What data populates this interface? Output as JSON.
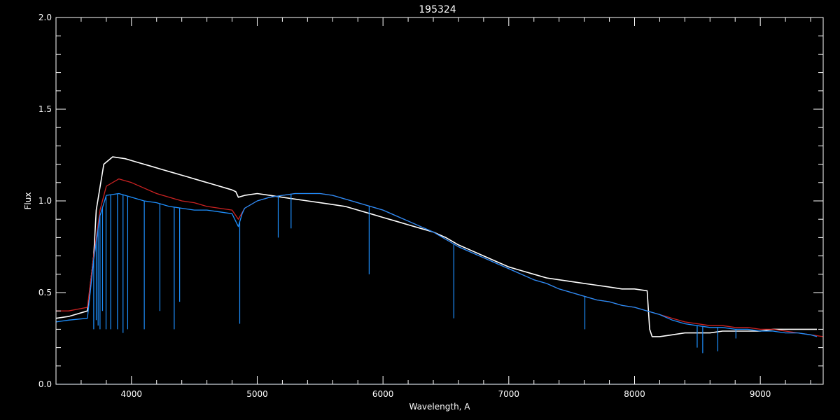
{
  "chart_data": {
    "type": "line",
    "title": "195324",
    "xlabel": "Wavelength, A",
    "ylabel": "Flux",
    "xlim": [
      3400,
      9500
    ],
    "ylim": [
      0.0,
      2.0
    ],
    "x_ticks": [
      4000,
      5000,
      6000,
      7000,
      8000,
      9000
    ],
    "y_ticks": [
      0.0,
      0.5,
      1.0,
      1.5,
      2.0
    ],
    "y_tick_labels": [
      "0.0",
      "0.5",
      "1.0",
      "1.5",
      "2.0"
    ],
    "grid": false,
    "background": "#000000",
    "axis_color": "#ffffff",
    "series": [
      {
        "color": "#ffffff",
        "x": [
          3400,
          3500,
          3650,
          3700,
          3720,
          3780,
          3850,
          3950,
          4050,
          4150,
          4250,
          4350,
          4450,
          4550,
          4650,
          4750,
          4800,
          4830,
          4850,
          4900,
          5000,
          5100,
          5200,
          5300,
          5400,
          5500,
          5600,
          5700,
          5800,
          5900,
          6000,
          6100,
          6200,
          6300,
          6400,
          6500,
          6600,
          6700,
          6800,
          6900,
          7000,
          7100,
          7200,
          7300,
          7400,
          7500,
          7600,
          7700,
          7800,
          7900,
          8000,
          8100,
          8120,
          8140,
          8200,
          8300,
          8400,
          8500,
          8600,
          8700,
          8800,
          8900,
          9000,
          9100,
          9200,
          9300,
          9400,
          9450
        ],
        "y": [
          0.36,
          0.37,
          0.4,
          0.7,
          0.95,
          1.2,
          1.24,
          1.23,
          1.21,
          1.19,
          1.17,
          1.15,
          1.13,
          1.11,
          1.09,
          1.07,
          1.06,
          1.05,
          1.02,
          1.03,
          1.04,
          1.03,
          1.02,
          1.01,
          1.0,
          0.99,
          0.98,
          0.97,
          0.95,
          0.93,
          0.91,
          0.89,
          0.87,
          0.85,
          0.83,
          0.8,
          0.76,
          0.73,
          0.7,
          0.67,
          0.64,
          0.62,
          0.6,
          0.58,
          0.57,
          0.56,
          0.55,
          0.54,
          0.53,
          0.52,
          0.52,
          0.51,
          0.3,
          0.26,
          0.26,
          0.27,
          0.28,
          0.28,
          0.28,
          0.29,
          0.29,
          0.29,
          0.29,
          0.3,
          0.3,
          0.3,
          0.3,
          0.3
        ]
      },
      {
        "color": "#cc2222",
        "x": [
          3400,
          3500,
          3650,
          3700,
          3750,
          3800,
          3900,
          4000,
          4100,
          4200,
          4300,
          4400,
          4500,
          4600,
          4700,
          4800,
          4850,
          4900,
          5000,
          5100,
          5200,
          5300,
          5400,
          5500,
          5600,
          5700,
          5800,
          5900,
          6000,
          6100,
          6200,
          6300,
          6400,
          6500,
          6600,
          6700,
          6800,
          6900,
          7000,
          7100,
          7200,
          7300,
          7400,
          7500,
          7600,
          7700,
          7800,
          7900,
          8000,
          8100,
          8200,
          8300,
          8400,
          8500,
          8600,
          8700,
          8800,
          8900,
          9000,
          9100,
          9200,
          9300,
          9400,
          9500
        ],
        "y": [
          0.4,
          0.4,
          0.42,
          0.7,
          0.95,
          1.08,
          1.12,
          1.1,
          1.07,
          1.04,
          1.02,
          1.0,
          0.99,
          0.97,
          0.96,
          0.95,
          0.9,
          0.96,
          1.0,
          1.02,
          1.03,
          1.04,
          1.04,
          1.04,
          1.03,
          1.01,
          0.99,
          0.97,
          0.95,
          0.92,
          0.89,
          0.86,
          0.83,
          0.79,
          0.75,
          0.72,
          0.69,
          0.66,
          0.63,
          0.6,
          0.57,
          0.55,
          0.52,
          0.5,
          0.48,
          0.46,
          0.45,
          0.43,
          0.42,
          0.4,
          0.38,
          0.36,
          0.34,
          0.33,
          0.32,
          0.32,
          0.31,
          0.31,
          0.3,
          0.3,
          0.29,
          0.28,
          0.27,
          0.26
        ]
      },
      {
        "color": "#1e90ff",
        "x": [
          3400,
          3500,
          3650,
          3700,
          3750,
          3800,
          3900,
          4000,
          4100,
          4200,
          4300,
          4400,
          4500,
          4600,
          4700,
          4800,
          4850,
          4880,
          4900,
          5000,
          5100,
          5200,
          5300,
          5400,
          5500,
          5600,
          5700,
          5800,
          5900,
          6000,
          6100,
          6200,
          6300,
          6400,
          6500,
          6600,
          6700,
          6800,
          6900,
          7000,
          7100,
          7200,
          7300,
          7400,
          7500,
          7600,
          7700,
          7800,
          7900,
          8000,
          8100,
          8200,
          8300,
          8400,
          8500,
          8600,
          8700,
          8800,
          8900,
          9000,
          9100,
          9200,
          9300,
          9400,
          9450
        ],
        "y": [
          0.34,
          0.35,
          0.36,
          0.68,
          0.92,
          1.03,
          1.04,
          1.02,
          1.0,
          0.99,
          0.97,
          0.96,
          0.95,
          0.95,
          0.94,
          0.93,
          0.86,
          0.93,
          0.96,
          1.0,
          1.02,
          1.03,
          1.04,
          1.04,
          1.04,
          1.03,
          1.01,
          0.99,
          0.97,
          0.95,
          0.92,
          0.89,
          0.86,
          0.83,
          0.79,
          0.75,
          0.72,
          0.69,
          0.66,
          0.63,
          0.6,
          0.57,
          0.55,
          0.52,
          0.5,
          0.48,
          0.46,
          0.45,
          0.43,
          0.42,
          0.4,
          0.38,
          0.35,
          0.33,
          0.32,
          0.31,
          0.31,
          0.3,
          0.3,
          0.29,
          0.29,
          0.28,
          0.28,
          0.27,
          0.26
        ]
      },
      {
        "color": "#1e90ff",
        "x": [
          3400,
          9450
        ],
        "y": [
          0.0,
          0.0
        ]
      }
    ],
    "absorption_lines": {
      "color": "#1e90ff",
      "x": [
        3700,
        3720,
        3735,
        3750,
        3770,
        3798,
        3835,
        3889,
        3933,
        3970,
        4102,
        4226,
        4340,
        4383,
        4861,
        5167,
        5269,
        5890,
        6563,
        7605,
        8498,
        8542,
        8662,
        8806
      ],
      "y": [
        0.3,
        0.35,
        0.32,
        0.3,
        0.4,
        0.3,
        0.3,
        0.3,
        0.28,
        0.3,
        0.3,
        0.4,
        0.3,
        0.45,
        0.33,
        0.8,
        0.85,
        0.6,
        0.36,
        0.3,
        0.2,
        0.17,
        0.18,
        0.25
      ]
    }
  }
}
